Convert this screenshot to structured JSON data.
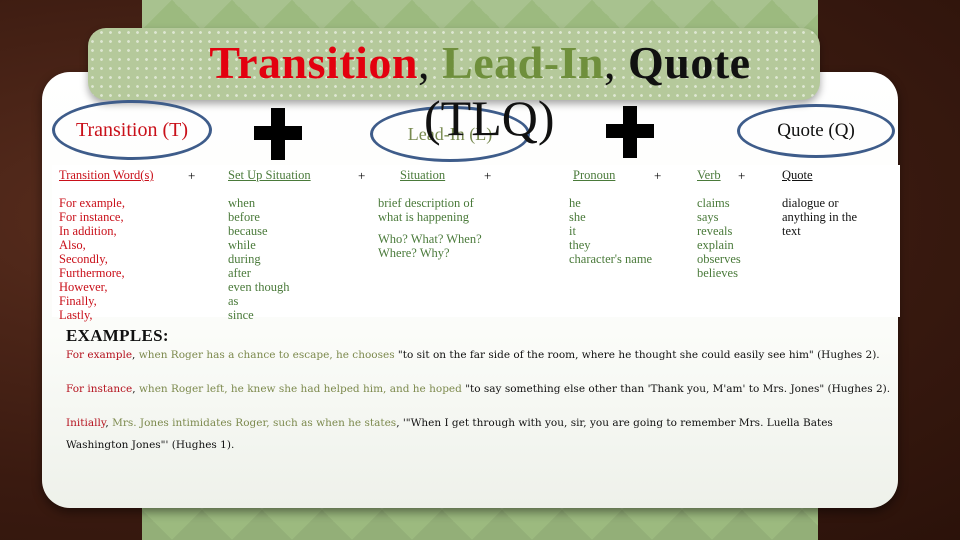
{
  "title": {
    "part1": "Transition",
    "part2": "Lead-In",
    "part3": "Quote",
    "separator": ",",
    "abbrev": "(TLQ)",
    "colors": {
      "transition": "#e3000f",
      "leadin": "#6f8f3c",
      "quote": "#111111"
    }
  },
  "ovals": {
    "transition": "Transition (T)",
    "leadin": "Lead-In (L)",
    "quote": "Quote (Q)"
  },
  "table": {
    "plus": "+",
    "columns": [
      {
        "header": "Transition Word(s)",
        "items": [
          "For example,",
          "For instance,",
          "In addition,",
          "Also,",
          "Secondly,",
          "Furthermore,",
          "However,",
          "Finally,",
          "Lastly,"
        ]
      },
      {
        "header": "Set Up Situation",
        "items": [
          "when",
          "before",
          "because",
          "while",
          "during",
          "after",
          "even though",
          "as",
          "since"
        ]
      },
      {
        "header": "Situation",
        "items": [
          "brief description of",
          "what is happening",
          "Who? What? When?",
          "Where? Why?"
        ]
      },
      {
        "header": "Pronoun",
        "items": [
          "he",
          "she",
          "it",
          "they",
          "character's name"
        ]
      },
      {
        "header": "Verb",
        "items": [
          "claims",
          "says",
          "reveals",
          "explain",
          "observes",
          "believes"
        ]
      },
      {
        "header": "Quote",
        "items": [
          "dialogue or",
          "anything in the",
          "text"
        ]
      }
    ]
  },
  "examples": {
    "heading": "EXAMPLES:",
    "items": [
      {
        "transition": "For example",
        "sep": ", ",
        "leadin": "when Roger has a chance to escape, he chooses",
        "quote": " \"to sit on the far side of the room, where he thought she could easily see him\" (Hughes 2)."
      },
      {
        "transition": "For instance",
        "sep": ", ",
        "leadin": "when Roger left, he knew she had helped him, and he hoped",
        "quote": " \"to say something else other than 'Thank you, M'am' to Mrs. Jones\" (Hughes 2)."
      },
      {
        "transition": "Initially",
        "sep": ", ",
        "leadin": "Mrs. Jones intimidates Roger, such as when he states",
        "quote": ", '\"When I get through with you, sir, you are going to remember Mrs. Luella Bates Washington Jones\"' (Hughes 1)."
      }
    ]
  }
}
